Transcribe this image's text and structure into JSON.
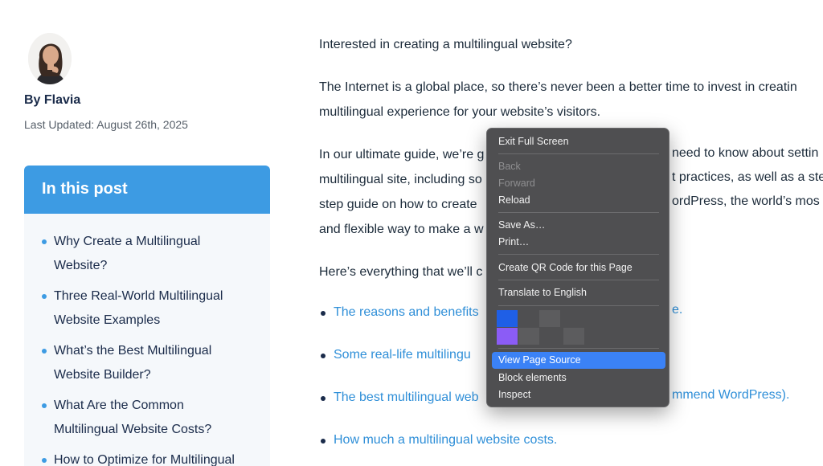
{
  "author": {
    "name": "By Flavia",
    "updated": "Last Updated: August 26th, 2025"
  },
  "toc": {
    "title": "In this post",
    "items": [
      "Why Create a Multilingual Website?",
      "Three Real-World Multilingual Website Examples",
      "What’s the Best Multilingual Website Builder?",
      "What Are the Common Multilingual Website Costs?",
      "How to Optimize for Multilingual"
    ]
  },
  "article": {
    "paragraphs": [
      [
        "Interested in creating a multilingual website?"
      ],
      [
        "The Internet is a global place, so there’s never been a better time to invest in creatin",
        "multilingual experience for your website’s visitors."
      ],
      [
        "In our ultimate guide, we’re g",
        "multilingual site, including so",
        "step guide on how to create",
        "and flexible way to make a w"
      ],
      [
        "Here’s everything that we’ll c"
      ]
    ],
    "paragraph_right_fragments": [
      "need to know about settin",
      "t practices, as well as a ste",
      "ordPress, the world’s mos"
    ],
    "bullets": [
      {
        "left": "The reasons and benefits",
        "right": "e."
      },
      {
        "left": "Some real-life multilingu",
        "right": ""
      },
      {
        "left": "The best multilingual web",
        "right": "mmend WordPress)."
      },
      {
        "left": "How much a multilingual website costs.",
        "right": ""
      }
    ]
  },
  "context_menu": {
    "items": {
      "exit_full_screen": "Exit Full Screen",
      "back": "Back",
      "forward": "Forward",
      "reload": "Reload",
      "save_as": "Save As…",
      "print": "Print…",
      "qr": "Create QR Code for this Page",
      "translate": "Translate to English",
      "view_source": "View Page Source",
      "block": "Block elements",
      "inspect": "Inspect"
    },
    "extension_icons": [
      {
        "name": "extension-blue-icon",
        "color": "#1f5fe6"
      },
      {
        "name": "extension-gray-icon",
        "color": "#5c5c5e"
      },
      {
        "name": "extension-purple-icon",
        "color": "#8b5cf6"
      },
      {
        "name": "extension-gray-icon",
        "color": "#5c5c5e"
      }
    ],
    "colors": {
      "background": "#4f4f51",
      "highlight": "#3b82f6"
    }
  },
  "colors": {
    "accent": "#3d9be3",
    "link": "#2f8fd8",
    "heading": "#1a2b4a"
  }
}
